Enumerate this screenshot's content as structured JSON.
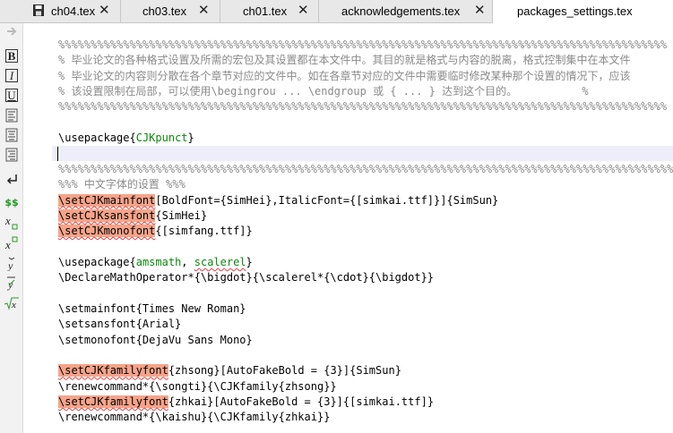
{
  "tabs": [
    {
      "label": "ch04.tex",
      "close": "✕",
      "active": false,
      "modified": true
    },
    {
      "label": "ch03.tex",
      "close": "✕",
      "active": false
    },
    {
      "label": "ch01.tex",
      "close": "✕",
      "active": false
    },
    {
      "label": "acknowledgements.tex",
      "close": "✕",
      "active": false
    },
    {
      "label": "packages_settings.tex",
      "close": "",
      "active": true
    }
  ],
  "toolbar": {
    "bold": "B",
    "italic": "I",
    "underline": "U",
    "dollars": "$$",
    "icons": [
      "forward-arrow-icon",
      "bold-icon",
      "italic-icon",
      "underline-icon",
      "align-left-icon",
      "align-center-icon",
      "align-right-icon",
      "newline-icon",
      "math-dollar-icon",
      "subscript-icon",
      "superscript-icon",
      "accent-y-icon",
      "bar-y-icon",
      "sqrt-icon"
    ]
  },
  "colors": {
    "comment": "#8a8a8a",
    "package_name": "#0a8a0a",
    "cjk_command_highlight": "#f5a48a",
    "cursor_line": "#eeeefa"
  },
  "editor": {
    "lines": [
      {
        "type": "comment",
        "text": "%%%%%%%%%%%%%%%%%%%%%%%%%%%%%%%%%%%%%%%%%%%%%%%%%%%%%%%%%%%%%%%%%%%%%%%%%%%%%%%%%%%%%%%%%%%%%%"
      },
      {
        "type": "comment",
        "text": "% 毕业论文的各种格式设置及所需的宏包及其设置都在本文件中。其目的就是格式与内容的脱离，格式控制集中在本文件"
      },
      {
        "type": "comment",
        "text": "% 毕业论文的内容则分散在各个章节对应的文件中。如在各章节对应的文件中需要临时修改某种那个设置的情况下，应该"
      },
      {
        "type": "comment",
        "text": "% 该设置限制在局部，可以使用\\begingrou ... \\endgroup 或 { ... } 达到这个目的。          %"
      },
      {
        "type": "comment",
        "text": "%%%%%%%%%%%%%%%%%%%%%%%%%%%%%%%%%%%%%%%%%%%%%%%%%%%%%%%%%%%%%%%%%%%%%%%%%%%%%%%%%%%%%%%%%%%%%%"
      },
      {
        "type": "blank",
        "text": ""
      },
      {
        "type": "usepackage",
        "cmd": "\\usepackage",
        "pkg": "CJKpunct"
      },
      {
        "type": "cursor",
        "text": ""
      },
      {
        "type": "comment",
        "text": "%%%%%%%%%%%%%%%%%%%%%%%%%%%%%%%%%%%%%%%%%%%%%%%%%%%%%%%%%%%%%%%%%%%%%%%%%%%%%%%%%%%%%%%%%%%%%%%%"
      },
      {
        "type": "comment",
        "text": "%%% 中文字体的设置 %%%"
      },
      {
        "type": "cjk",
        "cmd": "\\setCJKmainfont",
        "rest": "[BoldFont={SimHei},ItalicFont={[simkai.ttf]}]{SimSun}"
      },
      {
        "type": "cjk",
        "cmd": "\\setCJKsansfont",
        "rest": "{SimHei}"
      },
      {
        "type": "cjk",
        "cmd": "\\setCJKmonofont",
        "rest": "{[simfang.ttf]}"
      },
      {
        "type": "blank",
        "text": ""
      },
      {
        "type": "usepackage2",
        "cmd": "\\usepackage",
        "pkg1": "amsmath",
        "sep": ", ",
        "pkg2": "scalerel"
      },
      {
        "type": "plain",
        "text": "\\DeclareMathOperator*{\\bigdot}{\\scalerel*{\\cdot}{\\bigdot}}"
      },
      {
        "type": "blank",
        "text": ""
      },
      {
        "type": "plain",
        "text": "\\setmainfont{Times New Roman}"
      },
      {
        "type": "plain",
        "text": "\\setsansfont{Arial}"
      },
      {
        "type": "plain",
        "text": "\\setmonofont{DejaVu Sans Mono}"
      },
      {
        "type": "blank",
        "text": ""
      },
      {
        "type": "cjk",
        "cmd": "\\setCJKfamilyfont",
        "rest": "{zhsong}[AutoFakeBold = {3}]{SimSun}"
      },
      {
        "type": "plain",
        "text": "\\renewcommand*{\\songti}{\\CJKfamily{zhsong}}"
      },
      {
        "type": "cjk",
        "cmd": "\\setCJKfamilyfont",
        "rest": "{zhkai}[AutoFakeBold = {3}]{[simkai.ttf]}"
      },
      {
        "type": "plain",
        "text": "\\renewcommand*{\\kaishu}{\\CJKfamily{zhkai}}"
      }
    ]
  }
}
